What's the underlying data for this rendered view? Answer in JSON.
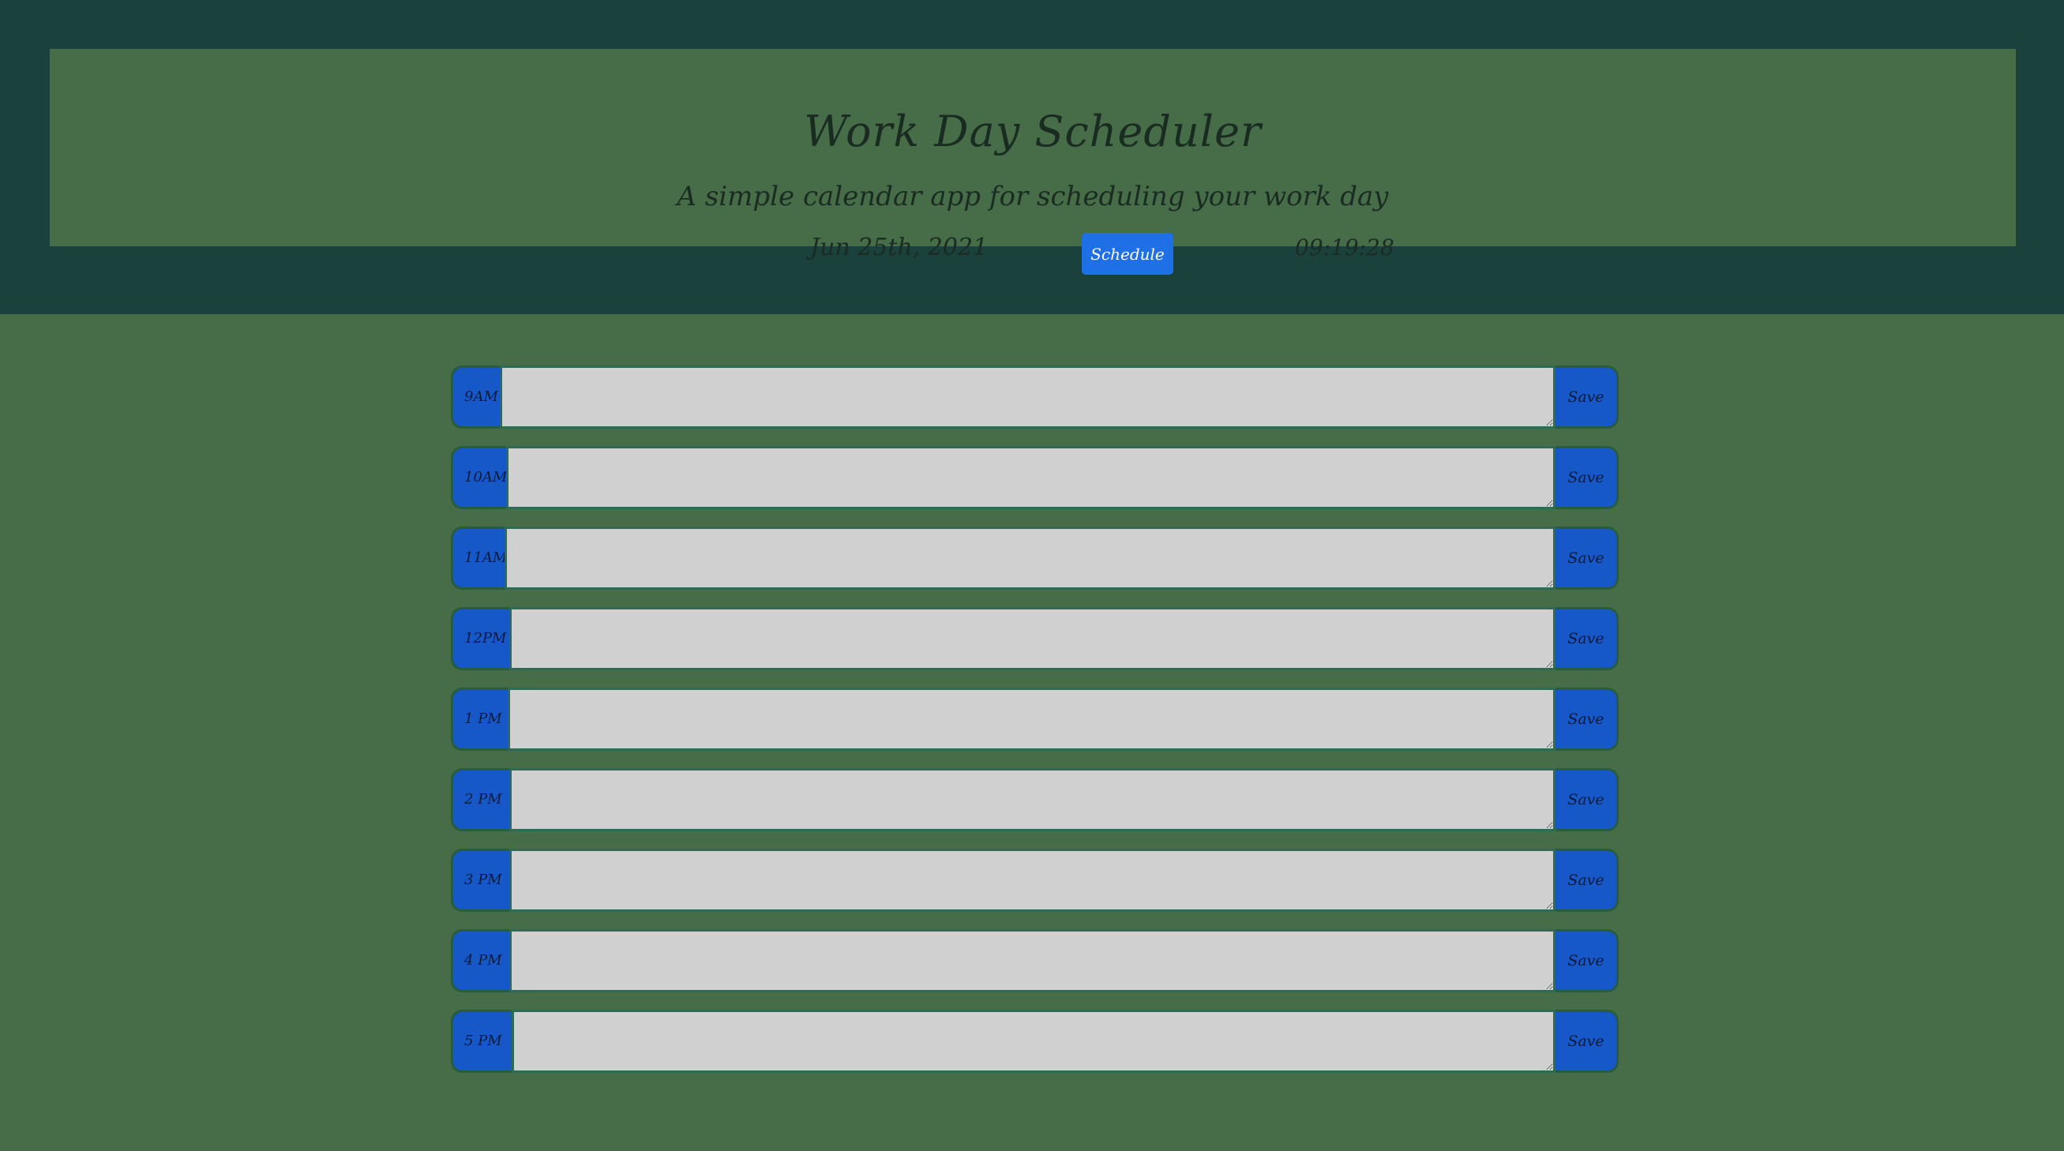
{
  "header": {
    "title": "Work Day Scheduler",
    "subtitle": "A simple calendar app for scheduling your work day",
    "date": "Jun 25th, 2021",
    "time": "09:19:28",
    "schedule_label": "Schedule"
  },
  "rows": [
    {
      "hour": "9AM",
      "text": "",
      "save_label": "Save"
    },
    {
      "hour": "10AM",
      "text": "",
      "save_label": "Save"
    },
    {
      "hour": "11AM",
      "text": "",
      "save_label": "Save"
    },
    {
      "hour": "12PM",
      "text": "",
      "save_label": "Save"
    },
    {
      "hour": "1 PM",
      "text": "",
      "save_label": "Save"
    },
    {
      "hour": "2 PM",
      "text": "",
      "save_label": "Save"
    },
    {
      "hour": "3 PM",
      "text": "",
      "save_label": "Save"
    },
    {
      "hour": "4 PM",
      "text": "",
      "save_label": "Save"
    },
    {
      "hour": "5 PM",
      "text": "",
      "save_label": "Save"
    }
  ],
  "colors": {
    "page_background": "#466d48",
    "top_band": "#1a413b",
    "hour_block": "#1758c8",
    "schedule_button": "#1f6fe6",
    "textarea": "#d0d0d0"
  }
}
